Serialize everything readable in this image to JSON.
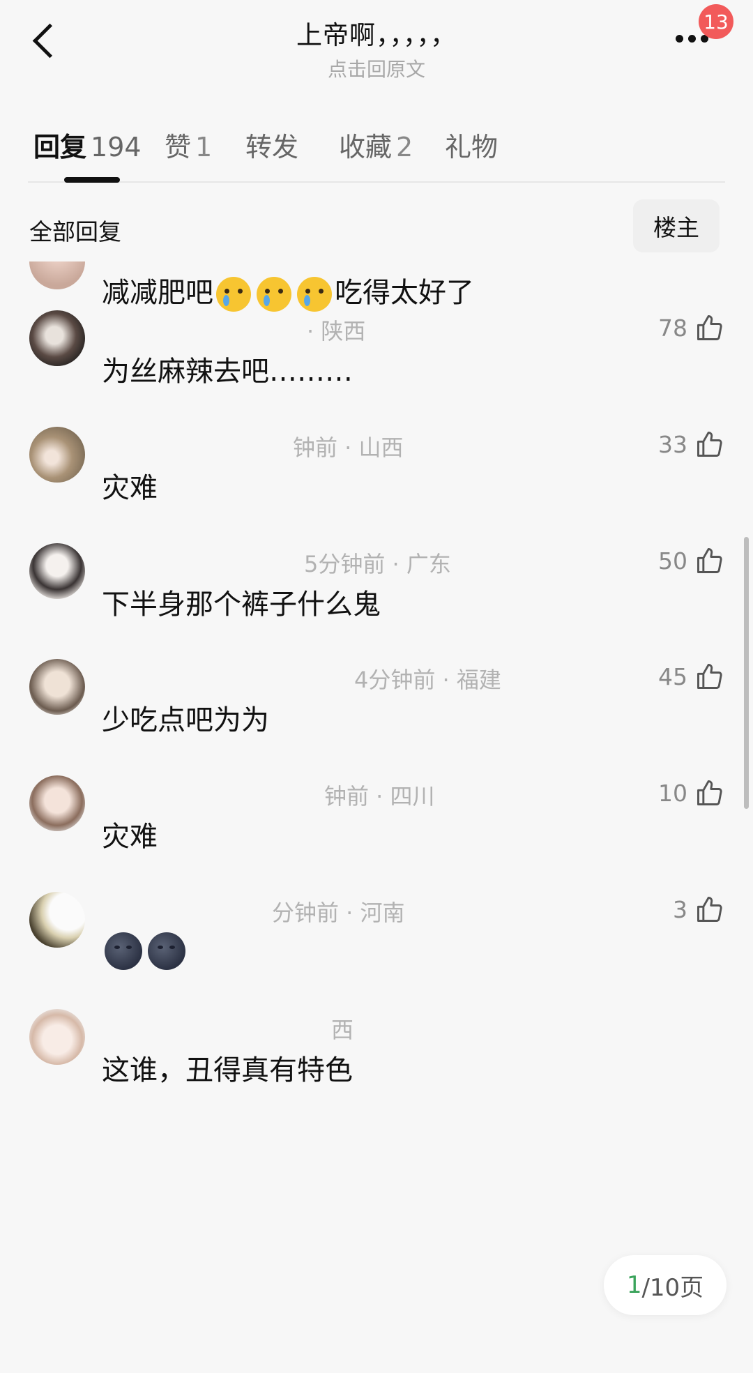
{
  "header": {
    "title": "上帝啊，，，，，",
    "subtitle": "点击回原文",
    "notification_count": "13"
  },
  "tabs": [
    {
      "label": "回复",
      "count": "194",
      "active": true
    },
    {
      "label": "赞",
      "count": "1"
    },
    {
      "label": "转发",
      "count": ""
    },
    {
      "label": "收藏",
      "count": "2"
    },
    {
      "label": "礼物",
      "count": ""
    }
  ],
  "filter": {
    "all_replies_label": "全部回复",
    "owner_button": "楼主"
  },
  "comments": [
    {
      "meta": "",
      "text_before": "减减肥吧",
      "text_after": "吃得太好了",
      "likes": "",
      "emoji": "cry",
      "emoji_count": 3
    },
    {
      "meta": "· 陕西",
      "text": "为丝麻辣去吧………",
      "likes": "78"
    },
    {
      "meta": "钟前 · 山西",
      "text": "灾难",
      "likes": "33"
    },
    {
      "meta": "5分钟前 · 广东",
      "text": "下半身那个裤子什么鬼",
      "likes": "50"
    },
    {
      "meta": "4分钟前 · 福建",
      "text": "少吃点吧为为",
      "likes": "45"
    },
    {
      "meta": "钟前 · 四川",
      "text": "灾难",
      "likes": "10"
    },
    {
      "meta": "分钟前 · 河南",
      "text": "",
      "likes": "3",
      "emoji": "moon",
      "emoji_count": 2
    },
    {
      "meta": "西",
      "text": "这谁，丑得真有特色",
      "likes": ""
    }
  ],
  "pager": {
    "current": "1",
    "total_text": "/10页"
  }
}
